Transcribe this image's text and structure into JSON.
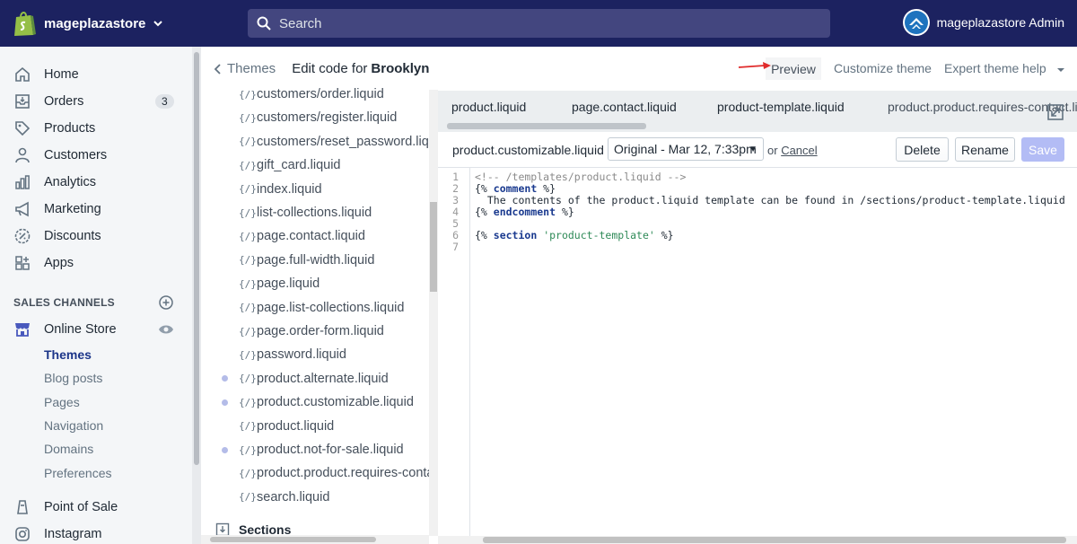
{
  "topbar": {
    "store_name": "mageplazastore",
    "search_placeholder": "Search",
    "admin_name": "mageplazastore Admin"
  },
  "sidebar": {
    "items": [
      {
        "label": "Home",
        "icon": "home-icon"
      },
      {
        "label": "Orders",
        "icon": "orders-icon",
        "badge": "3"
      },
      {
        "label": "Products",
        "icon": "tag-icon"
      },
      {
        "label": "Customers",
        "icon": "person-icon"
      },
      {
        "label": "Analytics",
        "icon": "bar-chart-icon"
      },
      {
        "label": "Marketing",
        "icon": "megaphone-icon"
      },
      {
        "label": "Discounts",
        "icon": "discount-icon"
      },
      {
        "label": "Apps",
        "icon": "apps-icon"
      }
    ],
    "sales_channels_label": "SALES CHANNELS",
    "online_store_label": "Online Store",
    "online_store_sub": [
      "Themes",
      "Blog posts",
      "Pages",
      "Navigation",
      "Domains",
      "Preferences"
    ],
    "point_of_sale_label": "Point of Sale",
    "instagram_label": "Instagram"
  },
  "breadcrumb": {
    "back_label": "Themes",
    "title_prefix": "Edit code for",
    "theme_name": "Brooklyn"
  },
  "header_actions": {
    "preview": "Preview",
    "customize": "Customize theme",
    "expert": "Expert theme help"
  },
  "files": [
    {
      "name": "customers/order.liquid",
      "dot": false
    },
    {
      "name": "customers/register.liquid",
      "dot": false
    },
    {
      "name": "customers/reset_password.liquid",
      "dot": false
    },
    {
      "name": "gift_card.liquid",
      "dot": false
    },
    {
      "name": "index.liquid",
      "dot": false
    },
    {
      "name": "list-collections.liquid",
      "dot": false
    },
    {
      "name": "page.contact.liquid",
      "dot": false
    },
    {
      "name": "page.full-width.liquid",
      "dot": false
    },
    {
      "name": "page.liquid",
      "dot": false
    },
    {
      "name": "page.list-collections.liquid",
      "dot": false
    },
    {
      "name": "page.order-form.liquid",
      "dot": false
    },
    {
      "name": "password.liquid",
      "dot": false
    },
    {
      "name": "product.alternate.liquid",
      "dot": true
    },
    {
      "name": "product.customizable.liquid",
      "dot": true
    },
    {
      "name": "product.liquid",
      "dot": false
    },
    {
      "name": "product.not-for-sale.liquid",
      "dot": true
    },
    {
      "name": "product.product.requires-contact.liquid",
      "dot": false
    },
    {
      "name": "search.liquid",
      "dot": false
    }
  ],
  "liquid_icon_text": "{/}",
  "sections_label": "Sections",
  "tabs": [
    "product.liquid",
    "page.contact.liquid",
    "product-template.liquid",
    "product.product.requires-contact.liquid"
  ],
  "editor": {
    "filename": "product.customizable.liquid",
    "version": "Original - Mar 12, 7:33pm",
    "or": "or",
    "cancel": "Cancel",
    "delete": "Delete",
    "rename": "Rename",
    "save": "Save"
  },
  "code_lines": [
    "<!-- /templates/product.liquid -->",
    "{% comment %}",
    "  The contents of the product.liquid template can be found in /sections/product-template.liquid",
    "{% endcomment %}",
    "",
    "{% section 'product-template' %}",
    ""
  ],
  "colors": {
    "topbar": "#1c2260",
    "search": "#43467f",
    "active_nav": "#1c3589",
    "save_disabled": "#b3bcf5",
    "arrow": "#e02b2b"
  }
}
